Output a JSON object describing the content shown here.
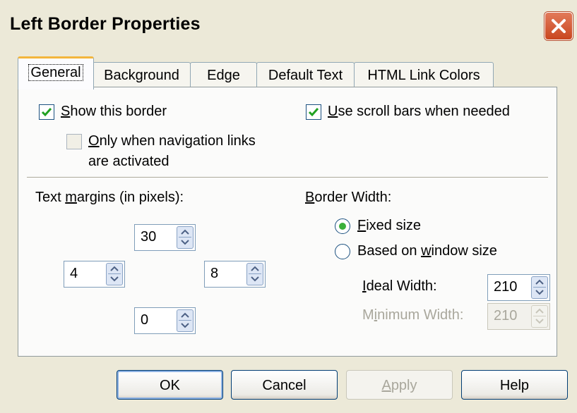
{
  "window": {
    "title": "Left Border Properties",
    "close_icon": "close-x-icon"
  },
  "tabs": [
    {
      "label": "General",
      "active": true
    },
    {
      "label": "Background",
      "active": false
    },
    {
      "label": "Edge",
      "active": false
    },
    {
      "label": "Default Text",
      "active": false
    },
    {
      "label": "HTML Link Colors",
      "active": false
    }
  ],
  "general": {
    "show_border": {
      "label_prefix": "S",
      "label_rest": "how this border",
      "checked": true
    },
    "only_when": {
      "label_line1_prefix": "O",
      "label_line1_rest": "nly when navigation links",
      "label_line2": "are activated",
      "checked": false
    },
    "scroll_bars": {
      "label_prefix": "U",
      "label_rest": "se scroll bars when needed",
      "checked": true
    },
    "text_margins": {
      "label_a": "Text ",
      "label_u": "m",
      "label_b": "argins (in pixels):",
      "top": "30",
      "left": "4",
      "right": "8",
      "bottom": "0"
    },
    "border_width": {
      "label_u": "B",
      "label_rest": "order Width:",
      "fixed": {
        "label_u": "F",
        "label_rest": "ixed size",
        "selected": true
      },
      "based": {
        "label_a": "Based on ",
        "label_u": "w",
        "label_b": "indow size",
        "selected": false
      },
      "ideal": {
        "label_u": "I",
        "label_rest": "deal Width:",
        "value": "210"
      },
      "minimum": {
        "label_a": "M",
        "label_u": "i",
        "label_b": "nimum Width:",
        "value": "210",
        "enabled": false
      }
    }
  },
  "buttons": {
    "ok": "OK",
    "cancel": "Cancel",
    "apply_u": "A",
    "apply_rest": "pply",
    "help": "Help"
  },
  "colors": {
    "dialog_bg": "#ece9d8",
    "close_red": "#c9461f",
    "tab_accent": "#f3b63c",
    "check_green": "#21a121"
  }
}
